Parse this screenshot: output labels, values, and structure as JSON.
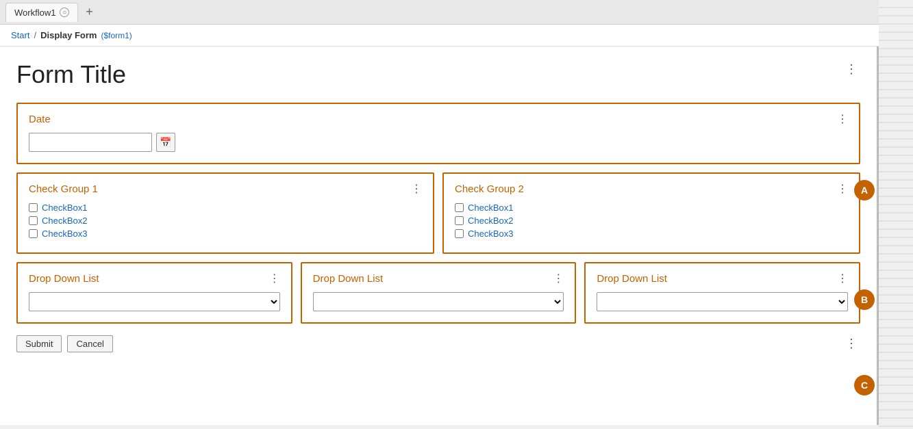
{
  "tab": {
    "label": "Workflow1",
    "close_icon": "○",
    "add_icon": "+"
  },
  "breadcrumb": {
    "start": "Start",
    "separator": "/",
    "current": "Display Form",
    "variable": "($form1)"
  },
  "form": {
    "title": "Form Title",
    "kebab_icon": "⋮",
    "sections": {
      "date": {
        "label": "Date",
        "placeholder": "",
        "calendar_icon": "📅"
      },
      "check_group_1": {
        "label": "Check Group 1",
        "checkboxes": [
          {
            "label": "CheckBox1"
          },
          {
            "label": "CheckBox2"
          },
          {
            "label": "CheckBox3"
          }
        ]
      },
      "check_group_2": {
        "label": "Check Group 2",
        "checkboxes": [
          {
            "label": "CheckBox1"
          },
          {
            "label": "CheckBox2"
          },
          {
            "label": "CheckBox3"
          }
        ]
      },
      "dropdown_1": {
        "label": "Drop Down List"
      },
      "dropdown_2": {
        "label": "Drop Down List"
      },
      "dropdown_3": {
        "label": "Drop Down List"
      }
    },
    "actions": {
      "submit": "Submit",
      "cancel": "Cancel"
    }
  },
  "side_labels": {
    "a": "A",
    "b": "B",
    "c": "C"
  },
  "icons": {
    "kebab": "⋮",
    "calendar": "▦",
    "chevron_down": "∨"
  }
}
